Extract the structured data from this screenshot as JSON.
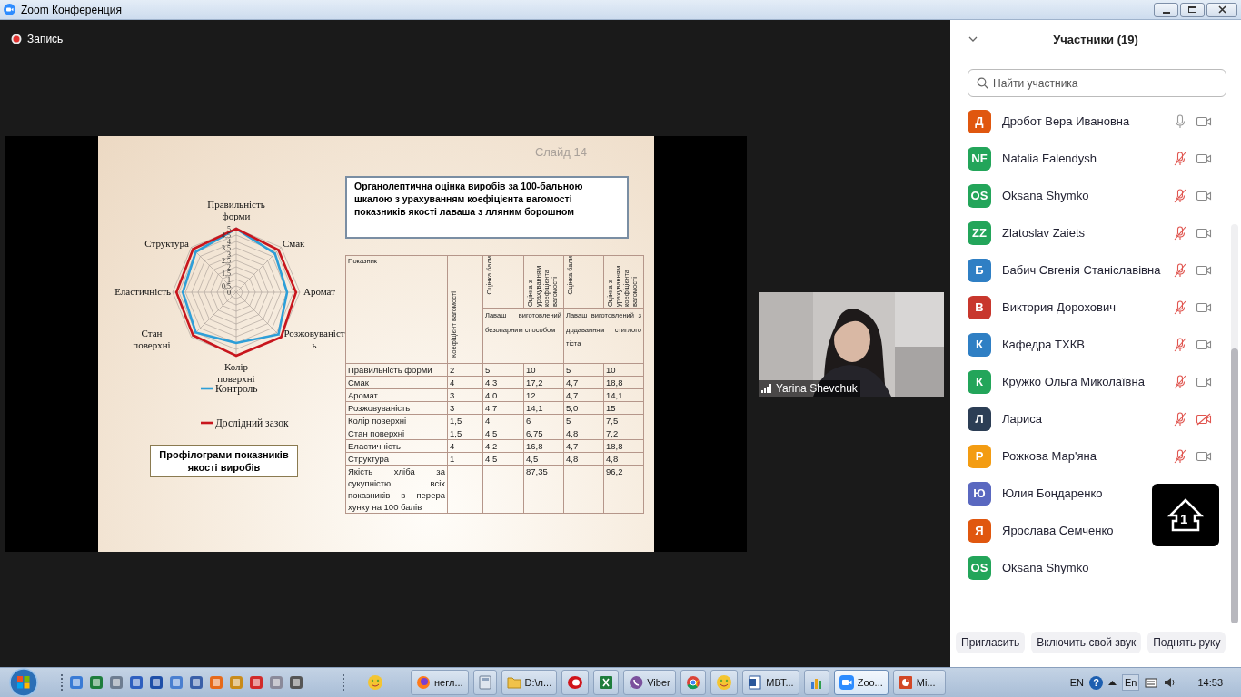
{
  "window": {
    "title": "Zoom Конференция"
  },
  "recording": {
    "label": "Запись"
  },
  "slide": {
    "slide_number": "Слайд 14",
    "heading": "Органолептична оцінка виробів  за 100-бальною шкалою з урахуванням коефіцієнта вагомості показників якості лаваша з лляним борошном",
    "chart_caption": "Профілограми показників якості виробів",
    "chart_data": {
      "type": "radar",
      "legend": "bottom",
      "categories": [
        "Правильність форми",
        "Смак",
        "Аромат",
        "Розжовуваність",
        "Колір поверхні",
        "Стан поверхні",
        "Еластичність",
        "Структура"
      ],
      "ylim": [
        0,
        5
      ],
      "yticks": [
        {
          "value": 0,
          "label": "0"
        },
        {
          "value": 0.5,
          "label": "0,5"
        },
        {
          "value": 1,
          "label": "1"
        },
        {
          "value": 1.5,
          "label": "1,5"
        },
        {
          "value": 2,
          "label": "2"
        },
        {
          "value": 2.5,
          "label": "2,5"
        },
        {
          "value": 3,
          "label": "3"
        },
        {
          "value": 3.5,
          "label": "3,5"
        },
        {
          "value": 4,
          "label": "4"
        },
        {
          "value": 4.5,
          "label": "4,5"
        },
        {
          "value": 5,
          "label": "5"
        }
      ],
      "series": [
        {
          "name": "Контроль",
          "color": "#2e9fd8",
          "values": [
            5,
            4.3,
            4.0,
            4.7,
            4,
            4.5,
            4.2,
            4.5
          ]
        },
        {
          "name": "Дослідний зазок",
          "color": "#c8161d",
          "values": [
            5,
            4.7,
            4.7,
            5.0,
            5,
            4.8,
            4.7,
            4.8
          ]
        }
      ]
    },
    "table": {
      "columns": [
        "Показник",
        "Коефіцієнт вагомості",
        "Оцінка бали",
        "Оцінка з урахуванням коефіцієнта вагомості",
        "Оцінка бали",
        "Оцінка з урахуванням коефіцієнта вагомості"
      ],
      "groups": [
        "Лаваш виготовлений безопарним способом",
        "Лаваш виготовлений з додаванням стиглого тіста"
      ],
      "rows": [
        [
          "Правильність форми",
          "2",
          "5",
          "10",
          "5",
          "10"
        ],
        [
          "Смак",
          "4",
          "4,3",
          "17,2",
          "4,7",
          "18,8"
        ],
        [
          "Аромат",
          "3",
          "4,0",
          "12",
          "4,7",
          "14,1"
        ],
        [
          "Розжовуваність",
          "3",
          "4,7",
          "14,1",
          "5,0",
          "15"
        ],
        [
          "Колір поверхні",
          "1,5",
          "4",
          "6",
          "5",
          "7,5"
        ],
        [
          "Стан поверхні",
          "1,5",
          "4,5",
          "6,75",
          "4,8",
          "7,2"
        ],
        [
          "Еластичність",
          "4",
          "4,2",
          "16,8",
          "4,7",
          "18,8"
        ],
        [
          "Структура",
          "1",
          "4,5",
          "4,5",
          "4,8",
          "4,8"
        ],
        [
          "Якість хліба за сукупністю всіх показників в перера хунку на 100 балів",
          null,
          null,
          "87,35",
          null,
          "96,2"
        ]
      ]
    }
  },
  "video": {
    "name": "Yarina Shevchuk"
  },
  "participants": {
    "title": "Участники (19)",
    "search": {
      "placeholder": "Найти участника"
    },
    "items": [
      {
        "initials": "Д",
        "color": "#e0570f",
        "name": "Дробот Вера Ивановна",
        "muted": false,
        "video_blocked": false
      },
      {
        "initials": "NF",
        "color": "#23a55a",
        "name": "Natalia Falendysh",
        "muted": true,
        "video_blocked": false
      },
      {
        "initials": "OS",
        "color": "#23a55a",
        "name": "Oksana Shymko",
        "muted": true,
        "video_blocked": false
      },
      {
        "initials": "ZZ",
        "color": "#23a55a",
        "name": "Zlatoslav Zaiets",
        "muted": true,
        "video_blocked": false
      },
      {
        "initials": "Б",
        "color": "#2f7fc4",
        "name": "Бабич Євгенія Станіславівна",
        "muted": true,
        "video_blocked": false
      },
      {
        "initials": "В",
        "color": "#c8372d",
        "name": "Виктория Дорохович",
        "muted": true,
        "video_blocked": false
      },
      {
        "initials": "К",
        "color": "#2f7fc4",
        "name": "Кафедра ТХКВ",
        "muted": true,
        "video_blocked": false
      },
      {
        "initials": "К",
        "color": "#23a55a",
        "name": "Кружко Ольга Миколаївна",
        "muted": true,
        "video_blocked": false
      },
      {
        "initials": "Л",
        "color": "#2c3e55",
        "name": "Лариса",
        "muted": true,
        "video_blocked": true
      },
      {
        "initials": "Р",
        "color": "#f39c12",
        "name": "Рожкова Мар'яна",
        "muted": true,
        "video_blocked": false
      },
      {
        "initials": "Ю",
        "color": "#5a68c0",
        "name": "Юлия Бондаренко"
      },
      {
        "initials": "Я",
        "color": "#e0570f",
        "name": "Ярослава Семченко"
      },
      {
        "initials": "OS",
        "color": "#23a55a",
        "name": "Oksana Shymko"
      }
    ],
    "buttons": [
      "Пригласить",
      "Включить свой звук",
      "Поднять руку"
    ]
  },
  "overlay": {
    "label": "1"
  },
  "taskbar": {
    "buttons": [
      {
        "kind": "globe",
        "label": "негл...",
        "selected": false
      },
      {
        "kind": "calculator",
        "selected": false
      },
      {
        "kind": "folder",
        "label": "D:\\л...",
        "selected": false
      },
      {
        "kind": "ring",
        "selected": false
      },
      {
        "kind": "sheet",
        "selected": false
      },
      {
        "kind": "phone",
        "label": "Viber",
        "selected": false
      },
      {
        "kind": "wheel",
        "selected": false
      },
      {
        "kind": "smiley",
        "selected": false
      },
      {
        "kind": "doc",
        "label": "МВТ...",
        "selected": false
      },
      {
        "kind": "bars",
        "selected": false
      },
      {
        "kind": "camera",
        "label": "Zoo...",
        "selected": true
      },
      {
        "kind": "slides",
        "label": "Mi...",
        "selected": false
      }
    ],
    "language": "EN",
    "help": "?",
    "input_language": "En",
    "time": "14:53"
  }
}
